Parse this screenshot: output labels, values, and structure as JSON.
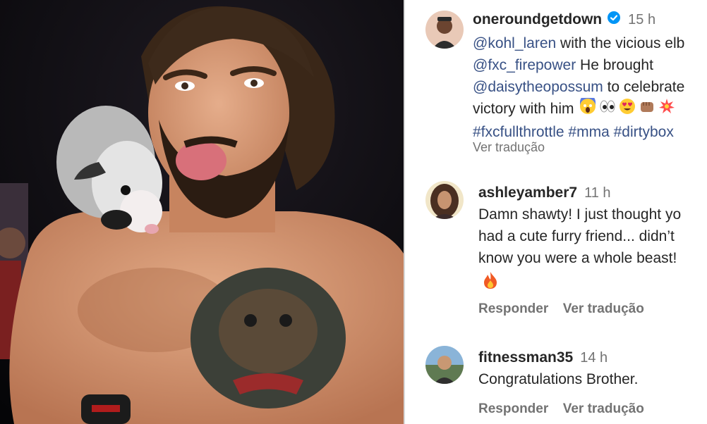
{
  "post": {
    "author": "oneroundgetdown",
    "time": "15 h",
    "caption_lines": [
      [
        {
          "t": "mention",
          "v": "@kohl_laren"
        },
        {
          "t": "text",
          "v": " with the vicious elb"
        }
      ],
      [
        {
          "t": "mention",
          "v": "@fxc_firepower"
        },
        {
          "t": "text",
          "v": "  He brought"
        }
      ],
      [
        {
          "t": "mention",
          "v": "@daisytheopossum"
        },
        {
          "t": "text",
          "v": " to celebrate"
        }
      ],
      [
        {
          "t": "text",
          "v": "victory with him "
        },
        {
          "t": "emoji",
          "v": "scream-emoji"
        },
        {
          "t": "emoji",
          "v": "eyes-emoji"
        },
        {
          "t": "emoji",
          "v": "heart-eyes-emoji"
        },
        {
          "t": "emoji",
          "v": "fist-emoji"
        },
        {
          "t": "emoji",
          "v": "collision-emoji"
        }
      ],
      [
        {
          "t": "tag",
          "v": "#fxcfullthrottle"
        },
        {
          "t": "text",
          "v": " "
        },
        {
          "t": "tag",
          "v": "#mma"
        },
        {
          "t": "text",
          "v": " "
        },
        {
          "t": "tag",
          "v": "#dirtybox"
        }
      ]
    ],
    "translate": "Ver tradução"
  },
  "comments": [
    {
      "username": "ashleyamber7",
      "time": "11 h",
      "lines": [
        "Damn shawty! I just thought yo",
        "had a cute furry friend... didn’t",
        "know you were a whole beast!"
      ],
      "emoji": "fire-emoji",
      "reply": "Responder",
      "translate": "Ver tradução"
    },
    {
      "username": "fitnessman35",
      "time": "14 h",
      "lines": [
        "Congratulations Brother."
      ],
      "reply": "Responder",
      "translate": "Ver tradução"
    }
  ],
  "colors": {
    "link": "#385185",
    "verified": "#0095f6",
    "secondary": "#737373",
    "text": "#262626"
  }
}
